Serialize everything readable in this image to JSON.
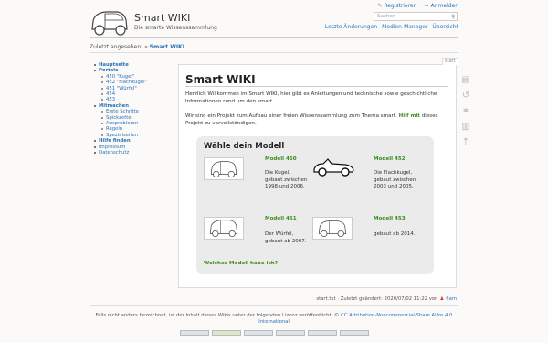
{
  "header": {
    "title": "Smart WIKI",
    "tagline": "Die smarte Wissenssammlung",
    "user_tools": {
      "register": "Registrieren",
      "login": "Anmelden"
    },
    "search": {
      "placeholder": "Suchen"
    },
    "site_tools": [
      "Letzte Änderungen",
      "Medien-Manager",
      "Übersicht"
    ]
  },
  "breadcrumb": {
    "label": "Zuletzt angesehen:",
    "sep": "»",
    "item": "Smart WIKI"
  },
  "sidebar": {
    "items": [
      {
        "level": 1,
        "label": "Hauptseite",
        "bold": true
      },
      {
        "level": 1,
        "label": "Portale",
        "bold": true
      },
      {
        "level": 2,
        "label": "450 \"Kugel\""
      },
      {
        "level": 2,
        "label": "452 \"Flachkugel\""
      },
      {
        "level": 2,
        "label": "451 \"Würfel\""
      },
      {
        "level": 2,
        "label": "454"
      },
      {
        "level": 2,
        "label": "453"
      },
      {
        "level": 1,
        "label": "Mitmachen",
        "bold": true
      },
      {
        "level": 2,
        "label": "Erste Schritte"
      },
      {
        "level": 2,
        "label": "Spickzettel"
      },
      {
        "level": 2,
        "label": "Ausprobieren"
      },
      {
        "level": 2,
        "label": "Regeln"
      },
      {
        "level": 2,
        "label": "Spezialseiten"
      },
      {
        "level": 1,
        "label": "Hilfe finden",
        "bold": true
      },
      {
        "level": 1,
        "label": "Impressum",
        "bold": false
      },
      {
        "level": 1,
        "label": "Datenschutz",
        "bold": false
      }
    ]
  },
  "page": {
    "tab": "start",
    "title": "Smart WIKI",
    "intro": "Herzlich Willkommen im Smart WIKI, hier gibt es Anleitungen und technische sowie geschichtliche Informationen rund um den smart.",
    "project_text": "Wir sind ein Projekt zum Aufbau einer freien Wissenssammlung zum Thema smart.",
    "help_link": "Hilf mit",
    "project_tail": "dieses Projekt zu vervollständigen.",
    "models_title": "Wähle dein Modell",
    "models": {
      "m450": {
        "name": "Modell 450",
        "desc": "Die Kugel, gebaut zwischen 1998 und 2006."
      },
      "m452": {
        "name": "Modell 452",
        "desc": "Die Flachkugel, gebaut zwischen 2003 und 2005."
      },
      "m451": {
        "name": "Modell 451",
        "desc": "Der Würfel, gebaut ab 2007."
      },
      "m453": {
        "name": "Modell 453",
        "desc": "gebaut ab 2014."
      }
    },
    "which_link": "Welches Modell habe ich?"
  },
  "footer": {
    "docinfo": "start.txt · Zuletzt geändert: 2020/07/02 11:22 von",
    "author": "flam",
    "license_text": "Falls nicht anders bezeichnet, ist der Inhalt dieses Wikis unter der folgenden Lizenz veröffentlicht:",
    "license_link": "CC Attribution-Noncommercial-Share Alike 4.0 International"
  },
  "colors": {
    "link": "#2b73b7",
    "accent_green": "#3c8c1f",
    "box_bg": "#ebebeb"
  }
}
